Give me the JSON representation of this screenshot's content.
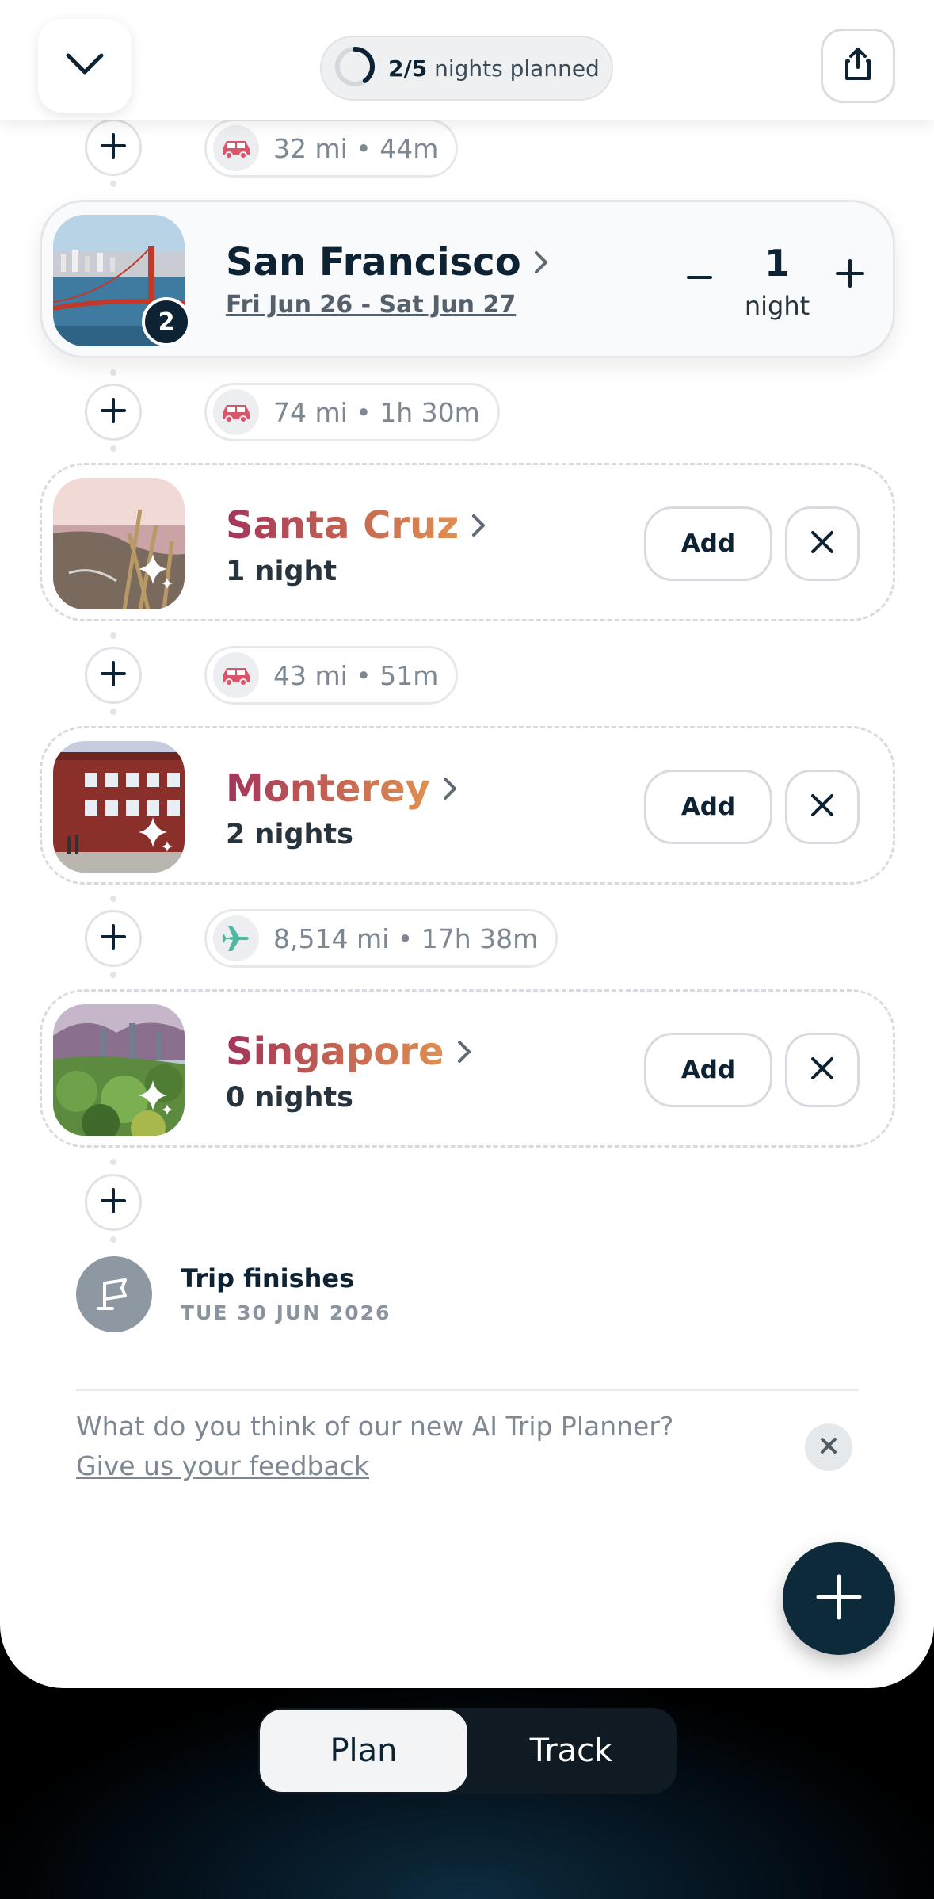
{
  "header": {
    "progress_done": "2/5",
    "progress_label": "nights planned",
    "progress_fraction": 0.4,
    "collapse_icon": "chevron-down-icon",
    "share_icon": "share-icon"
  },
  "legs": [
    {
      "mode": "car",
      "text": "32 mi • 44m"
    },
    {
      "mode": "car",
      "text": "74 mi • 1h 30m"
    },
    {
      "mode": "car",
      "text": "43 mi • 51m"
    },
    {
      "mode": "plane",
      "text": "8,514 mi • 17h 38m"
    }
  ],
  "stops": {
    "sf": {
      "name": "San Francisco",
      "dates": "Fri Jun 26 - Sat Jun 27",
      "order": "2",
      "nights_count": "1",
      "nights_unit": "night"
    },
    "santa_cruz": {
      "name": "Santa Cruz",
      "nights": "1 night",
      "add_label": "Add"
    },
    "monterey": {
      "name": "Monterey",
      "nights": "2 nights",
      "add_label": "Add"
    },
    "singapore": {
      "name": "Singapore",
      "nights": "0 nights",
      "add_label": "Add"
    }
  },
  "finish": {
    "title": "Trip finishes",
    "date": "TUE 30 JUN 2026"
  },
  "feedback": {
    "question": "What do you think of our new AI Trip Planner?",
    "link": "Give us your feedback"
  },
  "tabs": {
    "plan": "Plan",
    "track": "Track"
  },
  "colors": {
    "navy": "#0d2233",
    "car": "#d9556a",
    "plane": "#4fb7a2",
    "name_gradient_start": "#a3345a",
    "name_gradient_end": "#e0904f"
  }
}
